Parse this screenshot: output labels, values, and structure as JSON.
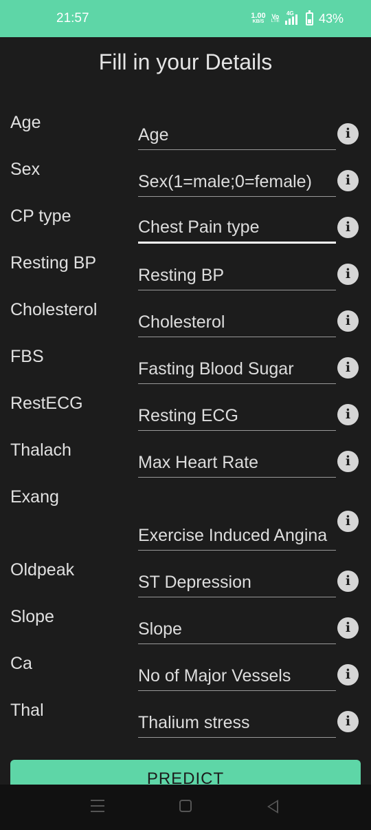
{
  "status_bar": {
    "time": "21:57",
    "net_speed_value": "1.00",
    "net_speed_unit": "KB/S",
    "volte_top": "Vo",
    "volte_bottom": "LTE",
    "network_type": "4G",
    "battery_percent": "43%",
    "battery_level": 0.43
  },
  "page": {
    "title": "Fill in your Details"
  },
  "form": {
    "fields": [
      {
        "label": "Age",
        "placeholder": "Age"
      },
      {
        "label": "Sex",
        "placeholder": "Sex(1=male;0=female)"
      },
      {
        "label": "CP type",
        "placeholder": "Chest Pain type"
      },
      {
        "label": "Resting BP",
        "placeholder": "Resting BP"
      },
      {
        "label": "Cholesterol",
        "placeholder": "Cholesterol"
      },
      {
        "label": "FBS",
        "placeholder": "Fasting Blood Sugar"
      },
      {
        "label": "RestECG",
        "placeholder": "Resting ECG"
      },
      {
        "label": "Thalach",
        "placeholder": "Max Heart Rate"
      },
      {
        "label": "Exang",
        "placeholder": "Exercise Induced Angina"
      },
      {
        "label": "Oldpeak",
        "placeholder": "ST Depression"
      },
      {
        "label": "Slope",
        "placeholder": "Slope"
      },
      {
        "label": "Ca",
        "placeholder": "No of Major Vessels"
      },
      {
        "label": "Thal",
        "placeholder": "Thalium stress"
      }
    ],
    "info_icon": "info-icon",
    "info_glyph": "i"
  },
  "predict_button": {
    "label": "PREDICT"
  },
  "colors": {
    "accent": "#5ed6a7",
    "background": "#1c1c1c"
  }
}
